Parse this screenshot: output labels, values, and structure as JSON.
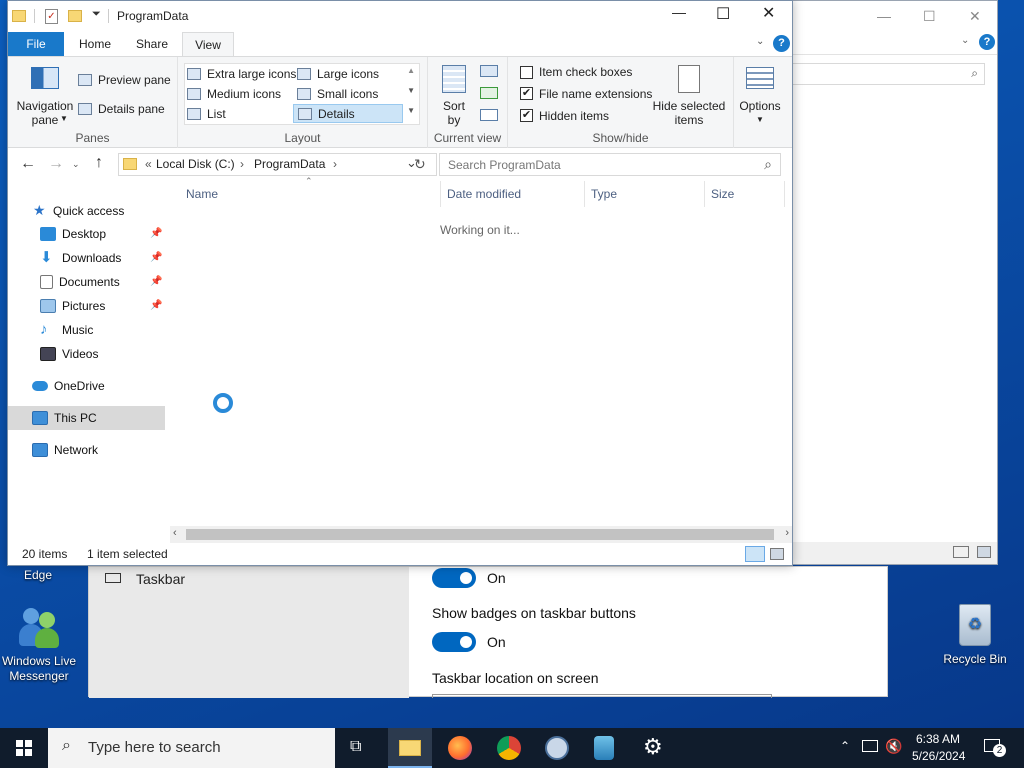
{
  "desktop": {
    "icons": {
      "edge_label": "Edge",
      "messenger_label": "Windows Live Messenger",
      "recycle_label": "Recycle Bin"
    }
  },
  "settings": {
    "taskbar_label": "Taskbar",
    "toggle1_state": "On",
    "badges_label": "Show badges on taskbar buttons",
    "toggle2_state": "On",
    "location_label": "Taskbar location on screen"
  },
  "explorer": {
    "title": "ProgramData",
    "tabs": [
      "File",
      "Home",
      "Share",
      "View"
    ],
    "active_tab": "View",
    "ribbon": {
      "panes": {
        "navigation_pane": "Navigation pane",
        "preview_pane": "Preview pane",
        "details_pane": "Details pane",
        "group_label": "Panes"
      },
      "layout": {
        "items": [
          "Extra large icons",
          "Large icons",
          "Medium icons",
          "Small icons",
          "List",
          "Details"
        ],
        "selected": "Details",
        "group_label": "Layout"
      },
      "current_view": {
        "sort_by": "Sort by",
        "group_label": "Current view"
      },
      "show_hide": {
        "item_check_boxes": "Item check boxes",
        "item_check_boxes_checked": false,
        "file_name_extensions": "File name extensions",
        "file_name_extensions_checked": true,
        "hidden_items": "Hidden items",
        "hidden_items_checked": true,
        "hide_selected_items": "Hide selected items",
        "group_label": "Show/hide"
      },
      "options_label": "Options"
    },
    "address": {
      "prefix": "«",
      "segments": [
        "Local Disk (C:)",
        "ProgramData"
      ]
    },
    "search_placeholder": "Search ProgramData",
    "columns": [
      "Name",
      "Date modified",
      "Type",
      "Size"
    ],
    "loading_text": "Working on it...",
    "nav": {
      "quick_access": "Quick access",
      "items": [
        "Desktop",
        "Downloads",
        "Documents",
        "Pictures",
        "Music",
        "Videos"
      ],
      "onedrive": "OneDrive",
      "this_pc": "This PC",
      "network": "Network"
    },
    "status": {
      "count": "20 items",
      "selected": "1 item selected"
    }
  },
  "taskbar": {
    "search_placeholder": "Type here to search",
    "time": "6:38 AM",
    "date": "5/26/2024",
    "notification_count": "2"
  }
}
